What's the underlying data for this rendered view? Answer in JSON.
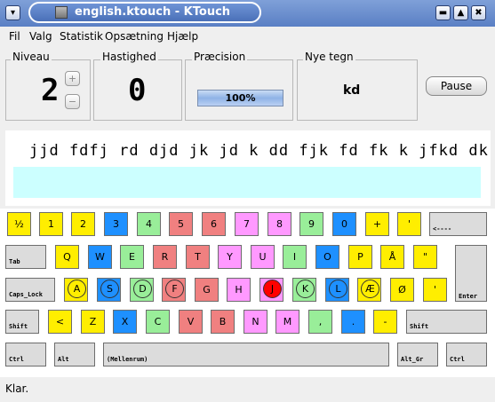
{
  "window": {
    "title": "english.ktouch - KTouch"
  },
  "menu": [
    "Fil",
    "Valg",
    "Statistik",
    "Opsætning",
    "Hjælp"
  ],
  "stats": {
    "level_label": "Niveau",
    "level_value": "2",
    "speed_label": "Hastighed",
    "speed_value": "0",
    "accuracy_label": "Præcision",
    "accuracy_value": "100%",
    "accuracy_fraction": 1.0,
    "newchars_label": "Nye tegn",
    "newchars_value": "kd",
    "pause_label": "Pause"
  },
  "lesson": {
    "line": "jjd fdfj rd djd jk jd k dd fjk fd fk k jfkd dk",
    "input": ""
  },
  "colors": {
    "red": "#f08080",
    "pink": "#ff99ff",
    "yellow": "#ffee00",
    "blue": "#1e90ff",
    "green": "#99ee99",
    "gray": "#dcdcdc",
    "highlight": "#ff0000"
  },
  "keyboard": {
    "row1": [
      "½",
      "1",
      "2",
      "3",
      "4",
      "5",
      "6",
      "7",
      "8",
      "9",
      "0",
      "+",
      "'",
      "<----"
    ],
    "row2": [
      "Tab",
      "Q",
      "W",
      "E",
      "R",
      "T",
      "Y",
      "U",
      "I",
      "O",
      "P",
      "Å",
      "\""
    ],
    "row3": [
      "Caps_Lock",
      "A",
      "S",
      "D",
      "F",
      "G",
      "H",
      "J",
      "K",
      "L",
      "Æ",
      "Ø",
      "'",
      "Enter"
    ],
    "row4": [
      "Shift",
      "<",
      "Z",
      "X",
      "C",
      "V",
      "B",
      "N",
      "M",
      ",",
      ".",
      "-",
      "Shift"
    ],
    "row5": [
      "Ctrl",
      "Alt",
      "(Mellenrum)",
      "Alt_Gr",
      "Ctrl"
    ]
  },
  "status": {
    "text": "Klar."
  }
}
